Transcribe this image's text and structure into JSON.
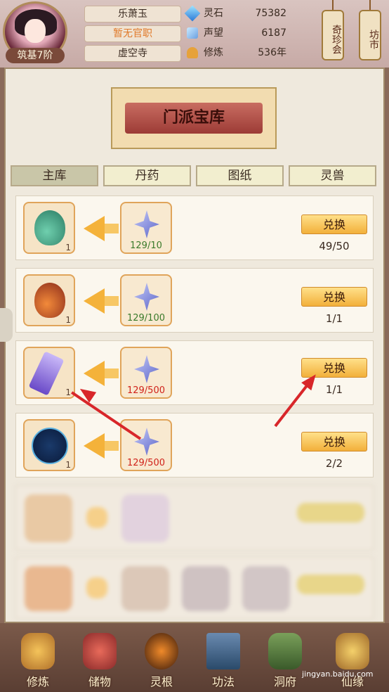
{
  "header": {
    "rank": "筑基7阶",
    "name": "乐萧玉",
    "title": "暂无官职",
    "sect": "虚空寺",
    "stats": [
      {
        "label": "灵石",
        "value": "75382",
        "icon": "spirit-stone-icon"
      },
      {
        "label": "声望",
        "value": "6187",
        "icon": "reputation-icon"
      },
      {
        "label": "修炼",
        "value": "536年",
        "icon": "cultivation-icon"
      }
    ],
    "side_buttons": [
      "奇珍会",
      "坊市"
    ]
  },
  "banner": {
    "title": "门派宝库"
  },
  "tabs": [
    {
      "label": "主库",
      "active": true
    },
    {
      "label": "丹药",
      "active": false
    },
    {
      "label": "图纸",
      "active": false
    },
    {
      "label": "灵兽",
      "active": false
    }
  ],
  "rows": [
    {
      "item": "jade-gourd",
      "item_count": "1",
      "cost": "129/10",
      "cost_color": "green",
      "button": "兑换",
      "limit": "49/50"
    },
    {
      "item": "red-gourd",
      "item_count": "1",
      "cost": "129/100",
      "cost_color": "green",
      "button": "兑换",
      "limit": "1/1"
    },
    {
      "item": "scroll-talisman",
      "item_count": "1",
      "cost": "129/500",
      "cost_color": "red",
      "button": "兑换",
      "limit": "1/1"
    },
    {
      "item": "star-disk",
      "item_count": "1",
      "cost": "129/500",
      "cost_color": "red",
      "button": "兑换",
      "limit": "2/2"
    }
  ],
  "bottom_nav": [
    "修炼",
    "储物",
    "灵根",
    "功法",
    "洞府",
    "仙缘"
  ],
  "watermark": "jingyan.baidu.com",
  "colors": {
    "accent": "#f2b03a",
    "insufficient": "#d0221a",
    "sufficient": "#3a7a2a"
  }
}
